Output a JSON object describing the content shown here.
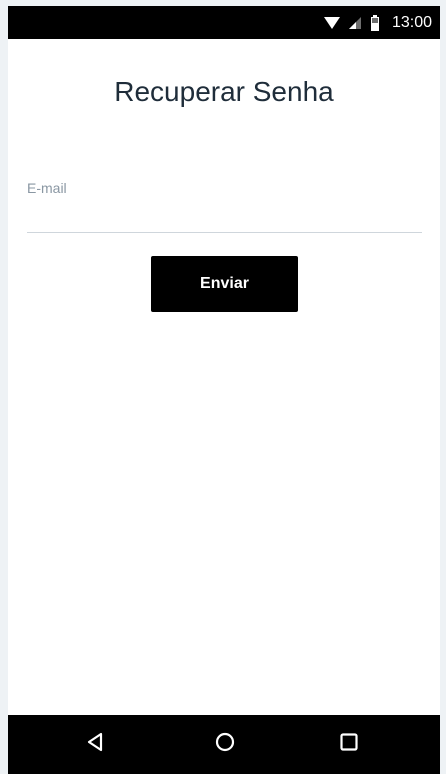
{
  "status_bar": {
    "time": "13:00",
    "icons": [
      "wifi-icon",
      "signal-icon",
      "battery-icon"
    ]
  },
  "screen": {
    "title": "Recuperar Senha",
    "email": {
      "label": "E-mail",
      "value": "",
      "placeholder": ""
    },
    "submit_label": "Enviar"
  },
  "nav_bar": {
    "buttons": [
      "back-icon",
      "home-icon",
      "recents-icon"
    ]
  },
  "colors": {
    "title": "#1f2d3a",
    "label": "#8a97a3",
    "button_bg": "#000000",
    "button_text": "#ffffff"
  }
}
